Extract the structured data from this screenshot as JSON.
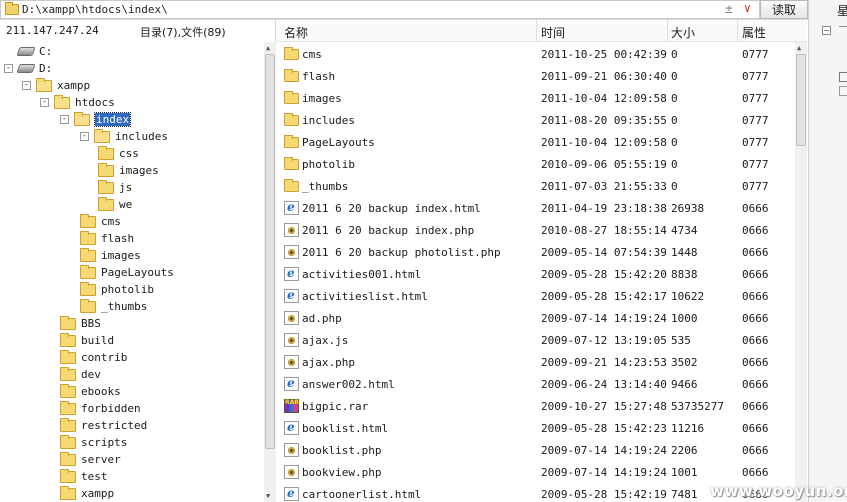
{
  "address_bar": {
    "path": "D:\\xampp\\htdocs\\index\\",
    "read_button": "读取",
    "plus_minus": "±",
    "dropdown": "∨"
  },
  "right_strip": {
    "label": "星"
  },
  "left_pane": {
    "ip": "211.147.247.24",
    "count_label": "目录(7),文件(89)",
    "tree": [
      {
        "label": "C:",
        "kind": "drive",
        "toggle": ""
      },
      {
        "label": "D:",
        "kind": "drive",
        "toggle": "-"
      },
      {
        "label": "xampp",
        "kind": "folder",
        "toggle": "-"
      },
      {
        "label": "htdocs",
        "kind": "folder",
        "toggle": "-"
      },
      {
        "label": "index",
        "kind": "folder",
        "toggle": "-",
        "selected": true
      },
      {
        "label": "includes",
        "kind": "folder",
        "toggle": "-"
      },
      {
        "label": "css",
        "kind": "folder",
        "toggle": ""
      },
      {
        "label": "images",
        "kind": "folder",
        "toggle": ""
      },
      {
        "label": "js",
        "kind": "folder",
        "toggle": ""
      },
      {
        "label": "we",
        "kind": "folder",
        "toggle": ""
      },
      {
        "label": "cms",
        "kind": "folder",
        "toggle": ""
      },
      {
        "label": "flash",
        "kind": "folder",
        "toggle": ""
      },
      {
        "label": "images",
        "kind": "folder",
        "toggle": ""
      },
      {
        "label": "PageLayouts",
        "kind": "folder",
        "toggle": ""
      },
      {
        "label": "photolib",
        "kind": "folder",
        "toggle": ""
      },
      {
        "label": "_thumbs",
        "kind": "folder",
        "toggle": ""
      },
      {
        "label": "BBS",
        "kind": "folder",
        "toggle": ""
      },
      {
        "label": "build",
        "kind": "folder",
        "toggle": ""
      },
      {
        "label": "contrib",
        "kind": "folder",
        "toggle": ""
      },
      {
        "label": "dev",
        "kind": "folder",
        "toggle": ""
      },
      {
        "label": "ebooks",
        "kind": "folder",
        "toggle": ""
      },
      {
        "label": "forbidden",
        "kind": "folder",
        "toggle": ""
      },
      {
        "label": "restricted",
        "kind": "folder",
        "toggle": ""
      },
      {
        "label": "scripts",
        "kind": "folder",
        "toggle": ""
      },
      {
        "label": "server",
        "kind": "folder",
        "toggle": ""
      },
      {
        "label": "test",
        "kind": "folder",
        "toggle": ""
      },
      {
        "label": "xampp",
        "kind": "folder",
        "toggle": ""
      }
    ]
  },
  "file_pane": {
    "columns": {
      "name": "名称",
      "time": "时间",
      "size": "大小",
      "attr": "属性"
    },
    "files": [
      {
        "name": "cms",
        "type": "folder",
        "time": "2011-10-25 00:42:39",
        "size": "0",
        "attr": "0777"
      },
      {
        "name": "flash",
        "type": "folder",
        "time": "2011-09-21 06:30:40",
        "size": "0",
        "attr": "0777"
      },
      {
        "name": "images",
        "type": "folder",
        "time": "2011-10-04 12:09:58",
        "size": "0",
        "attr": "0777"
      },
      {
        "name": "includes",
        "type": "folder",
        "time": "2011-08-20 09:35:55",
        "size": "0",
        "attr": "0777"
      },
      {
        "name": "PageLayouts",
        "type": "folder",
        "time": "2011-10-04 12:09:58",
        "size": "0",
        "attr": "0777"
      },
      {
        "name": "photolib",
        "type": "folder",
        "time": "2010-09-06 05:55:19",
        "size": "0",
        "attr": "0777"
      },
      {
        "name": "_thumbs",
        "type": "folder",
        "time": "2011-07-03 21:55:33",
        "size": "0",
        "attr": "0777"
      },
      {
        "name": "2011 6 20 backup index.html",
        "type": "html",
        "time": "2011-04-19 23:18:38",
        "size": "26938",
        "attr": "0666"
      },
      {
        "name": "2011 6 20 backup index.php",
        "type": "php",
        "time": "2010-08-27 18:55:14",
        "size": "4734",
        "attr": "0666"
      },
      {
        "name": "2011 6 20 backup photolist.php",
        "type": "php",
        "time": "2009-05-14 07:54:39",
        "size": "1448",
        "attr": "0666"
      },
      {
        "name": "activities001.html",
        "type": "html",
        "time": "2009-05-28 15:42:20",
        "size": "8838",
        "attr": "0666"
      },
      {
        "name": "activitieslist.html",
        "type": "html",
        "time": "2009-05-28 15:42:17",
        "size": "10622",
        "attr": "0666"
      },
      {
        "name": "ad.php",
        "type": "php",
        "time": "2009-07-14 14:19:24",
        "size": "1000",
        "attr": "0666"
      },
      {
        "name": "ajax.js",
        "type": "js",
        "time": "2009-07-12 13:19:05",
        "size": "535",
        "attr": "0666"
      },
      {
        "name": "ajax.php",
        "type": "php",
        "time": "2009-09-21 14:23:53",
        "size": "3502",
        "attr": "0666"
      },
      {
        "name": "answer002.html",
        "type": "html",
        "time": "2009-06-24 13:14:40",
        "size": "9466",
        "attr": "0666"
      },
      {
        "name": "bigpic.rar",
        "type": "rar",
        "time": "2009-10-27 15:27:48",
        "size": "53735277",
        "attr": "0666"
      },
      {
        "name": "booklist.html",
        "type": "html",
        "time": "2009-05-28 15:42:23",
        "size": "11216",
        "attr": "0666"
      },
      {
        "name": "booklist.php",
        "type": "php",
        "time": "2009-07-14 14:19:24",
        "size": "2206",
        "attr": "0666"
      },
      {
        "name": "bookview.php",
        "type": "php",
        "time": "2009-07-14 14:19:24",
        "size": "1001",
        "attr": "0666"
      },
      {
        "name": "cartoonerlist.html",
        "type": "html",
        "time": "2009-05-28 15:42:19",
        "size": "7481",
        "attr": "0666"
      }
    ]
  },
  "watermark": "www.wooyun.org"
}
